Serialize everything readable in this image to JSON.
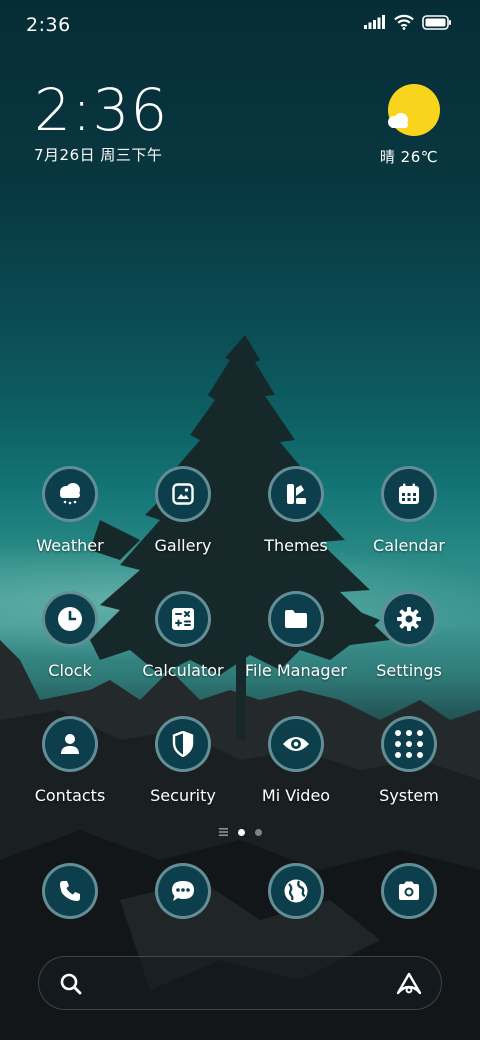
{
  "status_bar": {
    "time": "2:36",
    "icons": [
      "signal-icon",
      "wifi-icon",
      "battery-icon"
    ]
  },
  "clock_widget": {
    "time": "2:36",
    "date": "7月26日 周三下午"
  },
  "weather_widget": {
    "condition_temp": "晴 26℃",
    "icon": "sunny-cloud-icon",
    "sun_color": "#f9d41c"
  },
  "apps": [
    {
      "label": "Weather",
      "icon": "weather-cloud-icon"
    },
    {
      "label": "Gallery",
      "icon": "gallery-icon"
    },
    {
      "label": "Themes",
      "icon": "themes-icon"
    },
    {
      "label": "Calendar",
      "icon": "calendar-icon"
    },
    {
      "label": "Clock",
      "icon": "clock-icon"
    },
    {
      "label": "Calculator",
      "icon": "calculator-icon"
    },
    {
      "label": "File Manager",
      "icon": "folder-icon"
    },
    {
      "label": "Settings",
      "icon": "gear-icon"
    },
    {
      "label": "Contacts",
      "icon": "person-icon"
    },
    {
      "label": "Security",
      "icon": "shield-icon"
    },
    {
      "label": "Mi Video",
      "icon": "eye-icon"
    },
    {
      "label": "System",
      "icon": "folder-grid-icon"
    }
  ],
  "page_indicator": {
    "pages": 2,
    "active": 1
  },
  "dock": [
    {
      "icon": "phone-icon"
    },
    {
      "icon": "messages-icon"
    },
    {
      "icon": "browser-globe-icon"
    },
    {
      "icon": "camera-icon"
    }
  ],
  "search_bar": {
    "left_icon": "search-icon",
    "right_icon": "assistant-icon"
  },
  "colors": {
    "icon_bg": "#0c3f4b",
    "icon_ring": "#82aaaf"
  }
}
